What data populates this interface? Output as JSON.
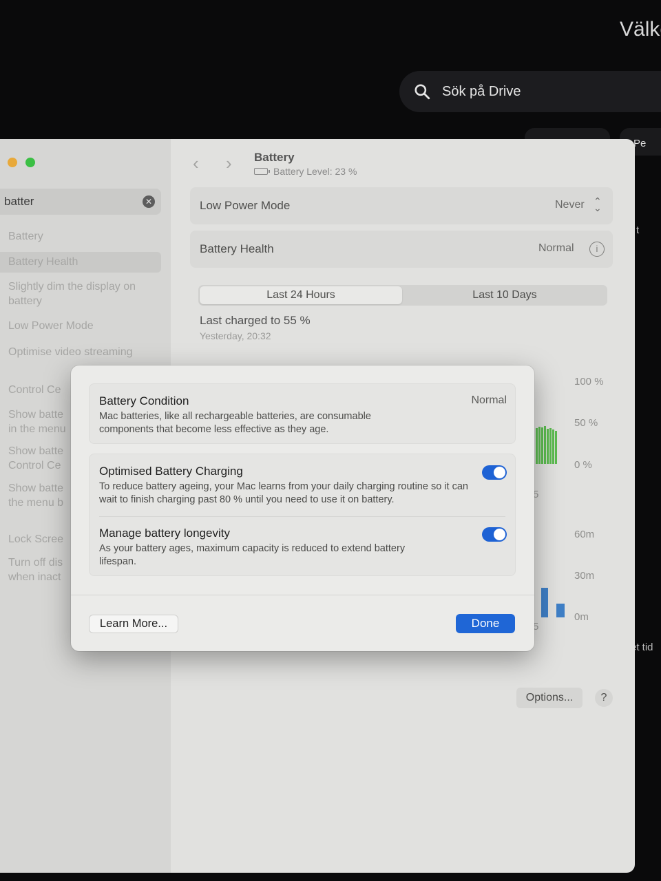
{
  "background": {
    "welcome_text": "Välkc",
    "drive_search": {
      "placeholder": "Sök på Drive",
      "icon": "search-icon"
    },
    "chip_b_text": "Pe",
    "edge_text_1": "t",
    "edge_text_2": "et tid"
  },
  "sidebar": {
    "search": {
      "value": "batter",
      "clear_icon": "clear-icon"
    },
    "results": [
      "Battery",
      "Battery Health",
      "Slightly dim the display on battery",
      "Low Power Mode",
      "Optimise video streaming",
      "Control Ce",
      "Show batte in the menu",
      "Show batte Control Ce",
      "Show batte the menu b",
      "Lock Scree",
      "Turn off dis when inact"
    ]
  },
  "header": {
    "title": "Battery",
    "subtitle": "Battery Level: 23 %"
  },
  "settings": {
    "low_power_mode": {
      "label": "Low Power Mode",
      "value": "Never"
    },
    "battery_health": {
      "label": "Battery Health",
      "value": "Normal"
    }
  },
  "usage": {
    "tabs": [
      "Last 24 Hours",
      "Last 10 Days"
    ],
    "active_tab": "Last 24 Hours",
    "last_charged": "Last charged to 55 %",
    "last_charged_time": "Yesterday, 20:32",
    "level_axis": [
      "100 %",
      "50 %",
      "0 %"
    ],
    "screen_axis": [
      "60m",
      "30m",
      "0m"
    ],
    "clipped_tick_1": "5",
    "clipped_tick_2": "5"
  },
  "footer": {
    "options_label": "Options...",
    "help_label": "?"
  },
  "modal": {
    "battery_condition": {
      "title": "Battery Condition",
      "value": "Normal",
      "description": "Mac batteries, like all rechargeable batteries, are consumable components that become less effective as they age."
    },
    "optimised_charging": {
      "title": "Optimised Battery Charging",
      "description": "To reduce battery ageing, your Mac learns from your daily charging routine so it can wait to finish charging past 80 % until you need to use it on battery.",
      "enabled": true
    },
    "manage_longevity": {
      "title": "Manage battery longevity",
      "description": "As your battery ages, maximum capacity is reduced to extend battery lifespan.",
      "enabled": true
    },
    "learn_more_label": "Learn More...",
    "done_label": "Done"
  },
  "colors": {
    "accent": "#1f66d6",
    "battery_level_bar": "#5bbb4f",
    "screen_on_bar": "#3f7fc6"
  }
}
